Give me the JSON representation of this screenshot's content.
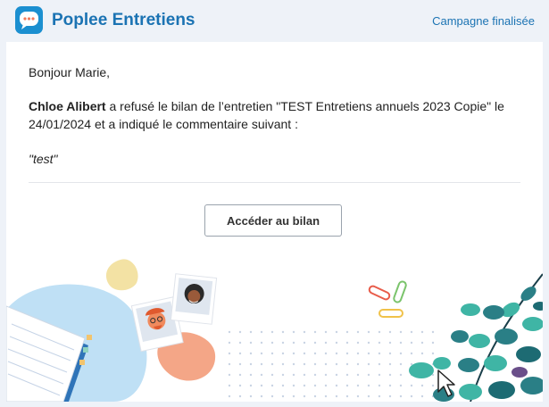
{
  "header": {
    "app_name": "Poplee Entretiens",
    "status_link": "Campagne finalisée",
    "logo_icon": "chat-bubble-icon",
    "brand_color": "#1b73b3"
  },
  "email": {
    "greeting": "Bonjour Marie,",
    "sender_name": "Chloe Alibert",
    "message_body": " a refusé le bilan de l’entretien \"TEST Entretiens annuels 2023 Copie\" le 24/01/2024 et a indiqué le commentaire suivant :",
    "comment": "\"test\""
  },
  "cta": {
    "label": "Accéder au bilan"
  },
  "illustration": {
    "icons": [
      "notebook-icon",
      "avatar-photo-man-icon",
      "avatar-photo-woman-icon",
      "paperclip-icon",
      "plant-leaves-icon",
      "mouse-cursor-icon"
    ]
  }
}
